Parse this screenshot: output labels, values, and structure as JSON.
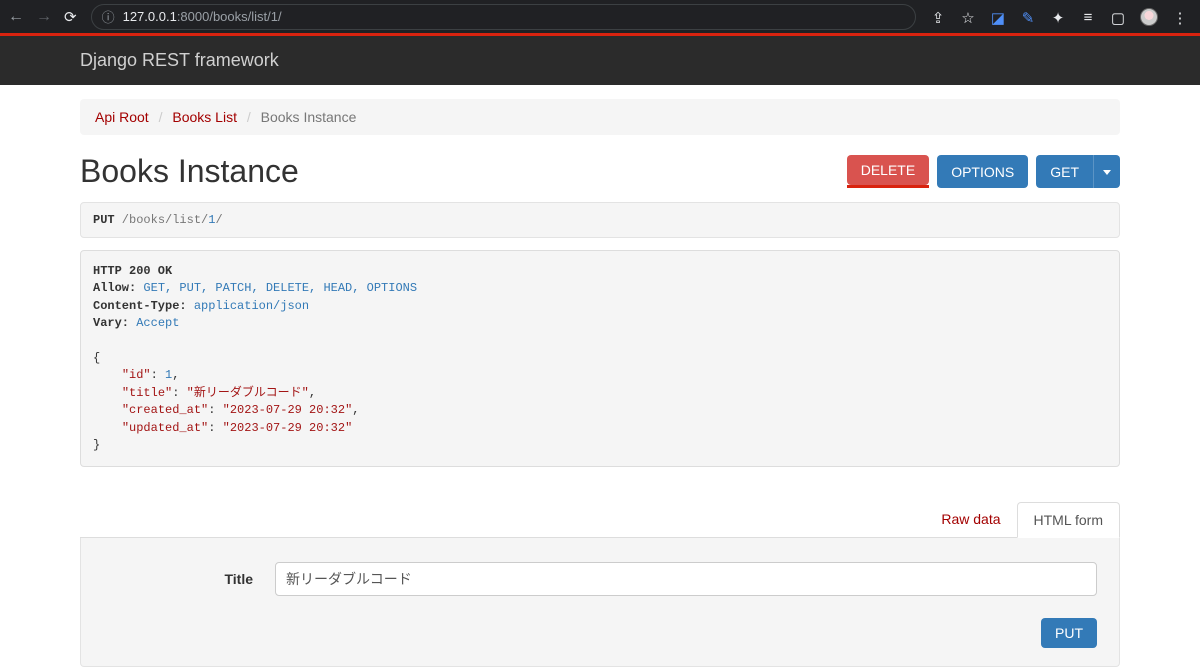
{
  "browser": {
    "url_host": "127.0.0.1",
    "url_port_path": ":8000/books/list/1/"
  },
  "brand": "Django REST framework",
  "breadcrumb": {
    "root": "Api Root",
    "list": "Books List",
    "current": "Books Instance"
  },
  "page_title": "Books Instance",
  "buttons": {
    "delete": "DELETE",
    "options": "OPTIONS",
    "get": "GET",
    "put": "PUT"
  },
  "request": {
    "method": "PUT",
    "path_prefix": " /books/list/",
    "path_id": "1",
    "path_suffix": "/"
  },
  "response": {
    "status": "HTTP 200 OK",
    "allow_label": "Allow:",
    "allow_value": "GET, PUT, PATCH, DELETE, HEAD, OPTIONS",
    "content_type_label": "Content-Type:",
    "content_type_value": "application/json",
    "vary_label": "Vary:",
    "vary_value": "Accept",
    "body": {
      "id": 1,
      "title": "新リーダブルコード",
      "created_at": "2023-07-29 20:32",
      "updated_at": "2023-07-29 20:32"
    }
  },
  "tabs": {
    "raw": "Raw data",
    "html": "HTML form"
  },
  "form": {
    "title_label": "Title",
    "title_value": "新リーダブルコード"
  }
}
